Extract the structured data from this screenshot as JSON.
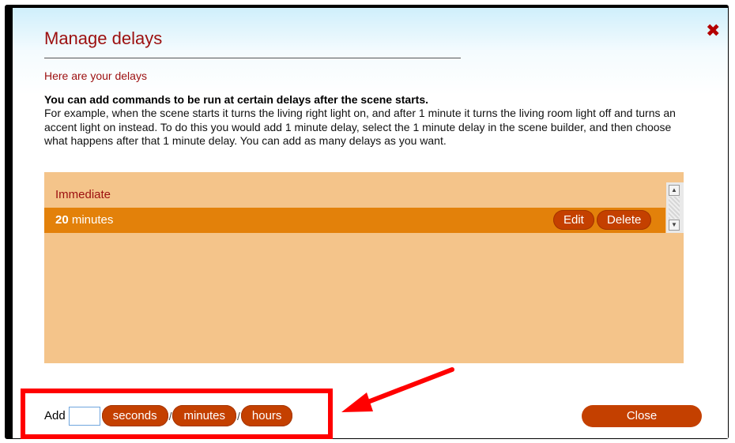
{
  "dialog": {
    "title": "Manage delays",
    "close_icon": "close-x-icon",
    "subtitle": "Here are your delays",
    "intro_bold": "You can add commands to be run at certain delays after the scene starts.",
    "intro_text": "For example, when the scene starts it turns the living right light on, and after 1 minute it turns the living room light off and turns an accent light on instead. To do this you would add 1 minute delay, select the 1 minute delay in the scene builder, and then choose what happens after that 1 minute delay. You can add as many delays as you want."
  },
  "delays": {
    "items": [
      {
        "label": "Immediate"
      },
      {
        "value": "20",
        "unit": " minutes",
        "selected": true
      }
    ],
    "edit_label": "Edit",
    "delete_label": "Delete"
  },
  "add": {
    "label": "Add",
    "input_value": "",
    "seconds_label": "seconds",
    "minutes_label": "minutes",
    "hours_label": "hours",
    "separator": "/"
  },
  "footer": {
    "close_label": "Close"
  },
  "colors": {
    "accent": "#c44000",
    "title": "#9c0f0f",
    "panel": "#f4c48a",
    "selected_row": "#e3810a",
    "annotation": "#ff0000"
  }
}
